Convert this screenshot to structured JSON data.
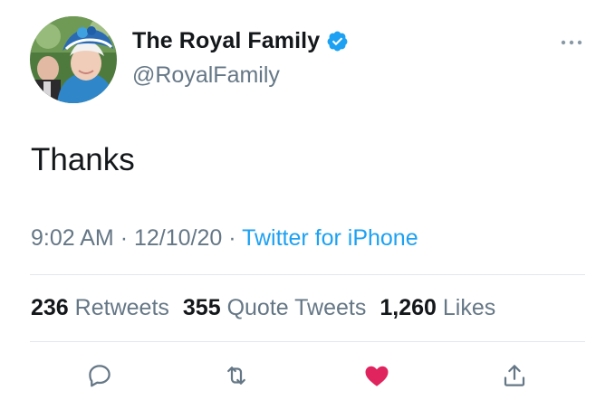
{
  "author": {
    "display_name": "The Royal Family",
    "handle": "@RoyalFamily",
    "verified": true,
    "avatar_icon": "profile-photo"
  },
  "tweet": {
    "text": "Thanks",
    "time": "9:02 AM",
    "separator": "·",
    "date": "12/10/20",
    "source": "Twitter for iPhone"
  },
  "stats": {
    "retweets": {
      "count": "236",
      "label": "Retweets"
    },
    "quote_tweets": {
      "count": "355",
      "label": "Quote Tweets"
    },
    "likes": {
      "count": "1,260",
      "label": "Likes"
    }
  },
  "actions": [
    {
      "name": "reply",
      "icon": "comment-icon"
    },
    {
      "name": "retweet",
      "icon": "retweet-icon"
    },
    {
      "name": "like",
      "icon": "heart-icon",
      "active": true
    },
    {
      "name": "share",
      "icon": "share-icon"
    }
  ],
  "colors": {
    "text_primary": "#14171a",
    "text_secondary": "#657786",
    "link": "#1da1f2",
    "verified": "#1da1f2",
    "like_active": "#e0245e",
    "divider": "#e1e8ed"
  }
}
